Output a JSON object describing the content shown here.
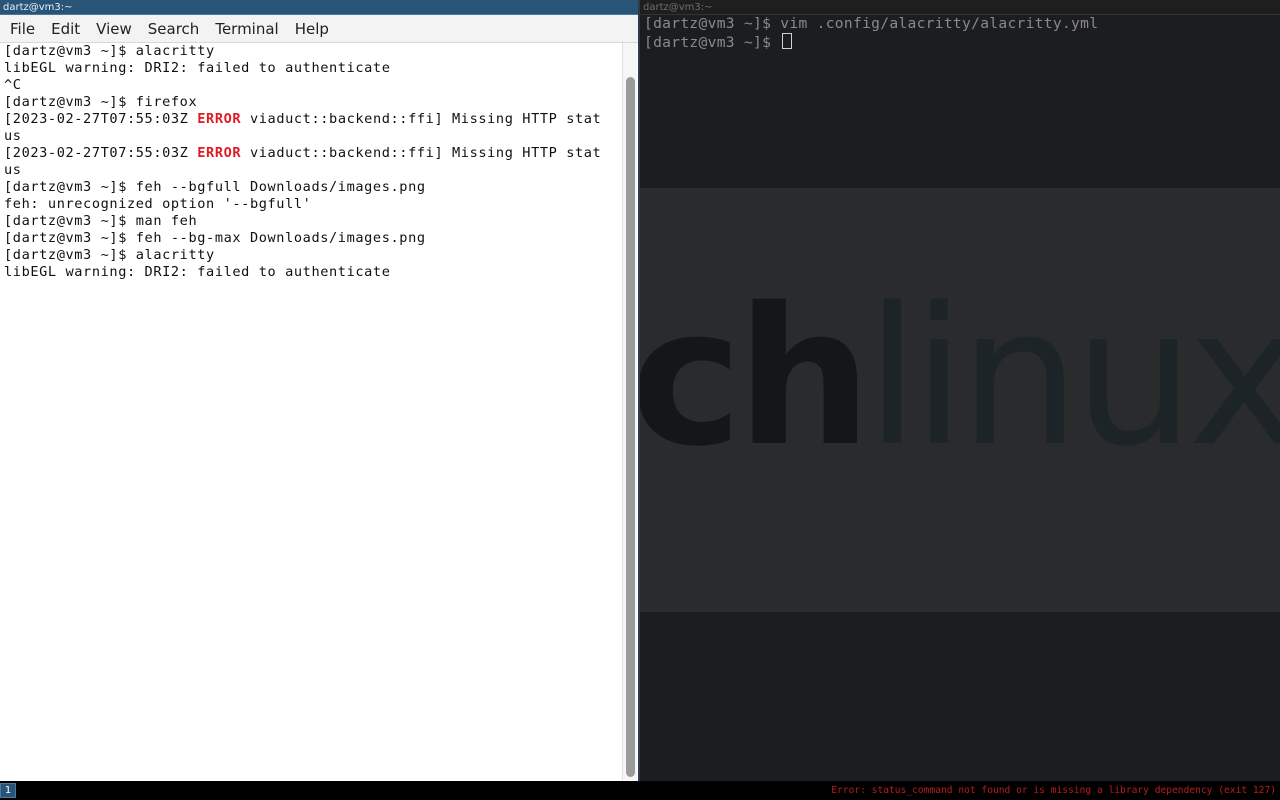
{
  "left_window": {
    "title": "dartz@vm3:~",
    "menu": [
      "File",
      "Edit",
      "View",
      "Search",
      "Terminal",
      "Help"
    ],
    "lines": [
      {
        "text": "[dartz@vm3 ~]$ alacritty"
      },
      {
        "text": "libEGL warning: DRI2: failed to authenticate"
      },
      {
        "text": "^C"
      },
      {
        "text": "[dartz@vm3 ~]$ firefox"
      },
      {
        "pre": "[2023-02-27T07:55:03Z ",
        "err": "ERROR",
        "post": " viaduct::backend::ffi] Missing HTTP stat"
      },
      {
        "text": "us"
      },
      {
        "pre": "[2023-02-27T07:55:03Z ",
        "err": "ERROR",
        "post": " viaduct::backend::ffi] Missing HTTP stat"
      },
      {
        "text": "us"
      },
      {
        "text": "[dartz@vm3 ~]$ feh --bgfull Downloads/images.png"
      },
      {
        "text": "feh: unrecognized option '--bgfull'"
      },
      {
        "text": "[dartz@vm3 ~]$ man feh"
      },
      {
        "text": "[dartz@vm3 ~]$ feh --bg-max Downloads/images.png"
      },
      {
        "text": "[dartz@vm3 ~]$ alacritty"
      },
      {
        "text": "libEGL warning: DRI2: failed to authenticate"
      }
    ]
  },
  "right_window": {
    "title": "dartz@vm3:~",
    "lines": [
      "[dartz@vm3 ~]$ vim .config/alacritty/alacritty.yml",
      "[dartz@vm3 ~]$ "
    ],
    "wallpaper": {
      "bold_text": "ch",
      "light_text": "linux"
    }
  },
  "statusbar": {
    "workspace": "1",
    "status_text": "Error: status_command not found or is missing a library dependency (exit 127)"
  },
  "colors": {
    "error_red": "#e01b24",
    "titlebar_focused": "#285577",
    "status_red": "#b81c1c"
  }
}
